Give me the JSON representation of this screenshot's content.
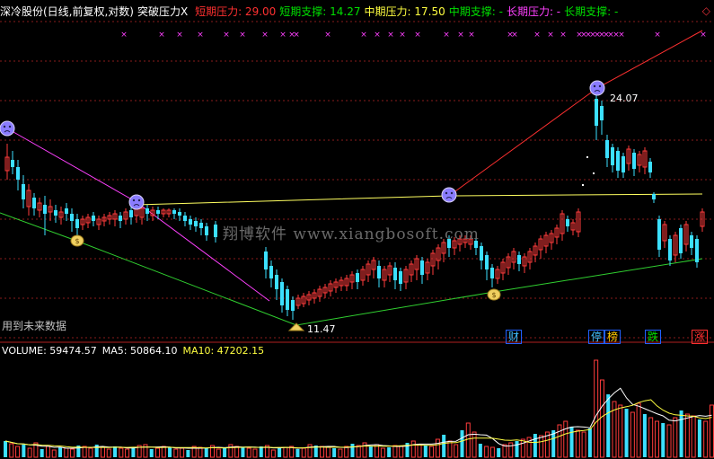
{
  "header": {
    "title": "深冷股份(日线,前复权,对数)",
    "indicator": "突破压力",
    "close_mark": "X",
    "items": [
      {
        "label": "短期压力:",
        "value": "29.00",
        "color": "#ff3030"
      },
      {
        "label": "短期支撑:",
        "value": "14.27",
        "color": "#00e000"
      },
      {
        "label": "中期压力:",
        "value": "17.50",
        "color": "#ffff40"
      },
      {
        "label": "中期支撑:",
        "value": "-",
        "color": "#00e000"
      },
      {
        "label": "长期压力:",
        "value": "-",
        "color": "#ff40ff"
      },
      {
        "label": "长期支撑:",
        "value": "-",
        "color": "#00e000"
      }
    ],
    "diamond": "◇"
  },
  "annotations": {
    "high_label": "24.07",
    "low_label": "11.47",
    "future_data_hint": "用到未来数据",
    "watermark": "翔博软件 www.xiangbosoft.com",
    "x_mark": "×"
  },
  "tags": [
    {
      "text": "财",
      "color": "#40c0ff",
      "border": "#2060ff"
    },
    {
      "text": "停",
      "color": "#40c0ff",
      "border": "#2060ff"
    },
    {
      "text": "榜",
      "color": "#ffcc00",
      "border": "#2060ff"
    },
    {
      "text": "跌",
      "color": "#00e000",
      "border": "#2060ff"
    },
    {
      "text": "涨",
      "color": "#ff3030",
      "border": "#ff3030"
    }
  ],
  "volume": {
    "items": [
      {
        "label": "VOLUME:",
        "value": "59474.57",
        "color": "#ffffff"
      },
      {
        "label": "MA5:",
        "value": "50864.10",
        "color": "#ffffff"
      },
      {
        "label": "MA10:",
        "value": "47202.15",
        "color": "#ffff40"
      }
    ]
  },
  "colors": {
    "up": "#ff3c3c",
    "down": "#3ce0ff",
    "resistance": "#ff3030",
    "support": "#30d030",
    "mid": "#ffff60",
    "long": "#ff40ff",
    "grid": "#8a1c1c"
  }
}
